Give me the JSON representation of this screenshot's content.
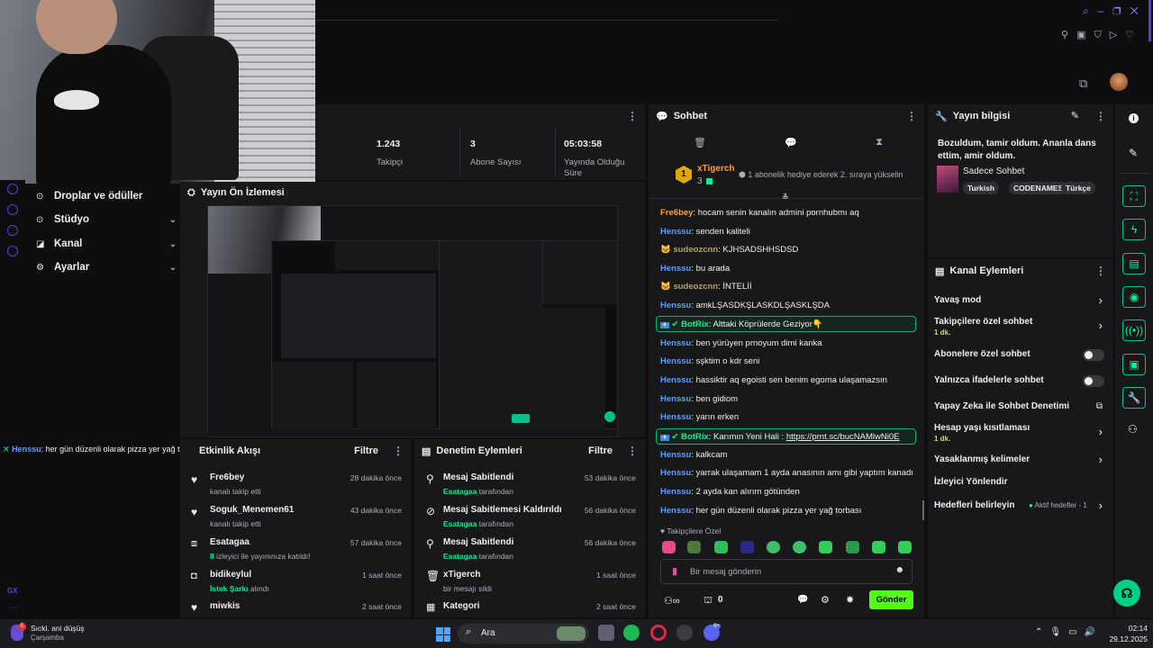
{
  "stats": {
    "followers_value": "1.243",
    "followers_label": "Takipçi",
    "subs_value": "3",
    "subs_label": "Abone Sayısı",
    "uptime_value": "05:03:58",
    "uptime_label": "Yayında Olduğu Süre"
  },
  "sidebar": {
    "items": [
      {
        "label": "Droplar ve ödüller"
      },
      {
        "label": "Stüdyo"
      },
      {
        "label": "Kanal"
      },
      {
        "label": "Ayarlar"
      }
    ],
    "gx_label": "GX"
  },
  "preview": {
    "title": "Yayın Ön İzlemesi"
  },
  "overlay_chat": {
    "user": "Henssu",
    "text": ": her gün düzenli olarak pizza yer yağ torbası"
  },
  "activity": {
    "title": "Etkinlik Akışı",
    "filter": "Filtre",
    "items": [
      {
        "name": "Fre6bey",
        "sub": "kanalı takip etti",
        "time": "28 dakika önce"
      },
      {
        "name": "Soguk_Menemen61",
        "sub": "kanalı takip etti",
        "time": "43 dakika önce"
      },
      {
        "name": "Esatagaa",
        "sub_hl": "8",
        "sub": "izleyici ile yayınınıza katıldı!",
        "time": "57 dakika önce"
      },
      {
        "name": "bidikeylul",
        "sub_hl": "İstek Şarkı",
        "sub": "alındı",
        "time": "1 saat önce"
      },
      {
        "name": "miwkis",
        "sub": "",
        "time": "2 saat önce"
      }
    ]
  },
  "moderation": {
    "title": "Denetim Eylemleri",
    "filter": "Filtre",
    "items": [
      {
        "title": "Mesaj Sabitlendi",
        "by": "Esatagaa",
        "by_suffix": "tarafından",
        "time": "53 dakika önce"
      },
      {
        "title": "Mesaj Sabitlemesi Kaldırıldı",
        "by": "Esatagaa",
        "by_suffix": "tarafından",
        "time": "56 dakika önce"
      },
      {
        "title": "Mesaj Sabitlendi",
        "by": "Esatagaa",
        "by_suffix": "tarafından",
        "time": "56 dakika önce"
      },
      {
        "title": "xTigerch",
        "by": "",
        "by_suffix": "bir mesajı sildi",
        "time": "1 saat önce"
      },
      {
        "title": "Kategori",
        "by": "",
        "by_suffix": "",
        "time": "2 saat önce"
      }
    ]
  },
  "chat": {
    "title": "Sohbet",
    "hype": {
      "rank": "1",
      "user": "xTigerch",
      "count": "3",
      "text": "1 abonelik hediye ederek 2. sıraya yükselin"
    },
    "messages": [
      {
        "user": "Fre6bey",
        "text": ": hocam senin kanalın admini pornhubmı aq",
        "color": "#ff9f2f"
      },
      {
        "user": "Henssu",
        "text": ": senden kaliteli",
        "color": "#5c9eff"
      },
      {
        "user": "sudeozcnn",
        "text": ": KJHSADSHHSDSD",
        "color": "#b8a16b"
      },
      {
        "user": "Henssu",
        "text": ": bu arada",
        "color": "#5c9eff"
      },
      {
        "user": "sudeozcnn",
        "text": ": İNTELİİ",
        "color": "#b8a16b"
      },
      {
        "user": "Henssu",
        "text": ": amkLŞASDKŞLASKDLŞASKLŞDA",
        "color": "#5c9eff"
      },
      {
        "user": "BotRix",
        "text": ": Alttaki Köprülerde Geziyor👇",
        "color": "#00f593",
        "bot": true
      },
      {
        "user": "Henssu",
        "text": ": ben yürüyen prnoyum dimi kanka",
        "color": "#5c9eff"
      },
      {
        "user": "Henssu",
        "text": ": sşktim o kdr seni",
        "color": "#5c9eff"
      },
      {
        "user": "Henssu",
        "text": ": hassiktir aq egoisti sen benim egoma ulaşamazsın",
        "color": "#5c9eff"
      },
      {
        "user": "Henssu",
        "text": ": ben gidiom",
        "color": "#5c9eff"
      },
      {
        "user": "Henssu",
        "text": ": yarın erken",
        "color": "#5c9eff"
      },
      {
        "user": "BotRix",
        "text": ": Karımın Yeni Hali : ",
        "link": "https://prnt.sc/bucNAMlwNi0E",
        "color": "#00f593",
        "bot": true
      },
      {
        "user": "Henssu",
        "text": ": kalkcam",
        "color": "#5c9eff"
      },
      {
        "user": "Henssu",
        "text": ": yarrak ulaşamam 1 ayda anasının amı gibi yaptım kanadı",
        "color": "#5c9eff"
      },
      {
        "user": "Henssu",
        "text": ": 2 ayda kan alırım götünden",
        "color": "#5c9eff"
      },
      {
        "user": "Henssu",
        "text": ": her gün düzenli olarak pizza yer yağ torbası",
        "color": "#5c9eff"
      }
    ],
    "emote_section": "Takipçilere Özel",
    "input_placeholder": "Bir mesaj gönderin",
    "points": "0",
    "send": "Gönder"
  },
  "stream_info": {
    "title": "Yayın bilgisi",
    "stream_title": "Bozuldum, tamir oldum. Ananla dans ettim, amir oldum.",
    "category": "Sadece Sohbet",
    "tags": [
      "Turkish",
      "CODENAMES",
      "Türkçe"
    ]
  },
  "channel_actions": {
    "title": "Kanal Eylemleri",
    "items": [
      {
        "label": "Yavaş mod",
        "sub": "",
        "ctrl": "chevron"
      },
      {
        "label": "Takipçilere özel sohbet",
        "sub": "1 dk.",
        "ctrl": "chevron"
      },
      {
        "label": "Abonelere özel sohbet",
        "sub": "",
        "ctrl": "toggle"
      },
      {
        "label": "Yalnızca ifadelerle sohbet",
        "sub": "",
        "ctrl": "toggle"
      },
      {
        "label": "Yapay Zeka ile Sohbet Denetimi",
        "sub": "",
        "ctrl": "external"
      },
      {
        "label": "Hesap yaşı kısıtlaması",
        "sub": "1 dk.",
        "ctrl": "chevron"
      },
      {
        "label": "Yasaklanmış kelimeler",
        "sub": "",
        "ctrl": "chevron"
      },
      {
        "label": "İzleyici Yönlendir",
        "sub": "",
        "ctrl": "none"
      },
      {
        "label": "Hedefleri belirleyin",
        "sub": "",
        "ctrl": "chevron",
        "badge": "Aktif hedefler - 1"
      }
    ]
  },
  "taskbar": {
    "weather_title": "Sıckl. ani düşüş",
    "weather_sub": "Çarşamba",
    "weather_badge": "5",
    "search": "Ara",
    "time": "02:14",
    "date": "29.12.2025",
    "discord_badge": "9+"
  },
  "colors": {
    "accent": "#00f593",
    "bg": "#0e0e10",
    "panel": "#18181b"
  }
}
